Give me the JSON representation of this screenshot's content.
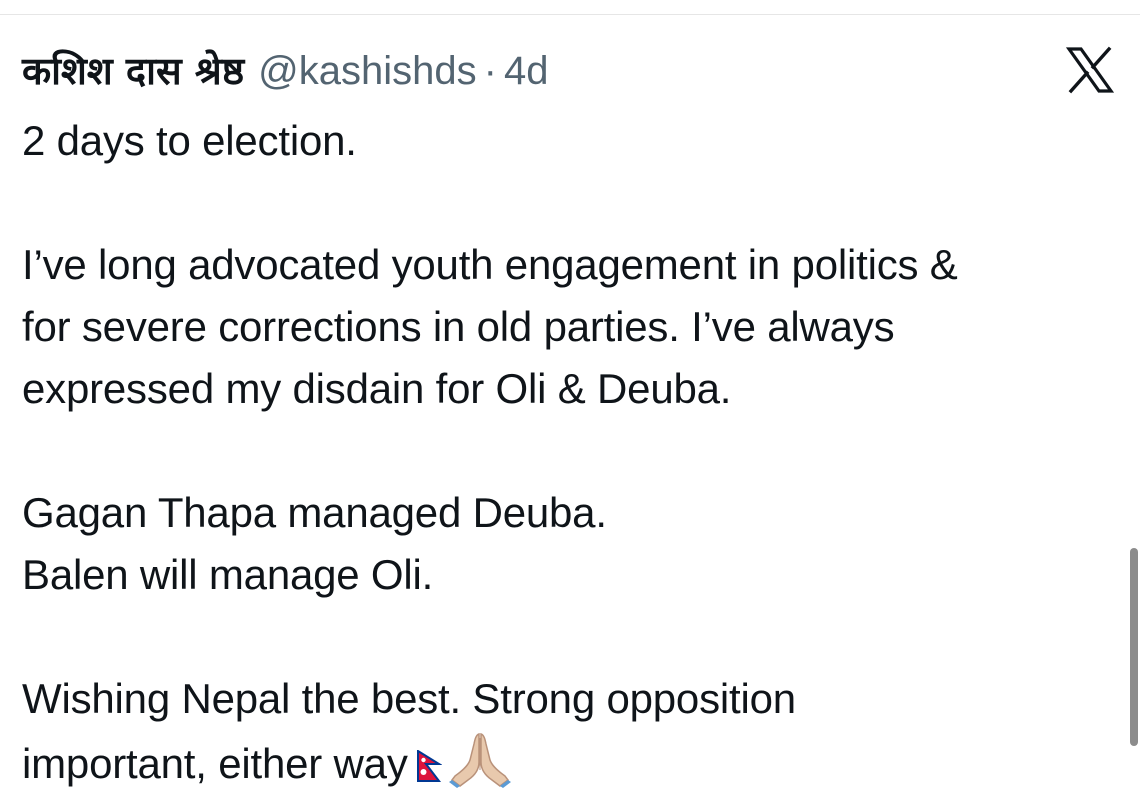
{
  "tweet": {
    "display_name": "कशिश दास श्रेष्ठ",
    "handle": "@kashishds",
    "separator": "·",
    "time": "4d",
    "paragraphs": [
      [
        "2 days to election."
      ],
      [
        "I’ve long advocated youth engagement in politics &",
        "for severe corrections in old parties. I’ve always",
        "expressed my disdain for Oli & Deuba."
      ],
      [
        "Gagan Thapa managed Deuba.",
        "Balen will manage Oli."
      ],
      [
        "Wishing Nepal the best. Strong opposition",
        "important, either way"
      ]
    ],
    "trailing_emoji": [
      "nepal-flag-icon",
      "praying-hands-icon"
    ]
  },
  "icons": {
    "platform_logo": "x-logo-icon"
  },
  "colors": {
    "text": "#0f1419",
    "secondary_text": "#536471",
    "flag_red": "#dc143c",
    "flag_blue": "#003893"
  }
}
